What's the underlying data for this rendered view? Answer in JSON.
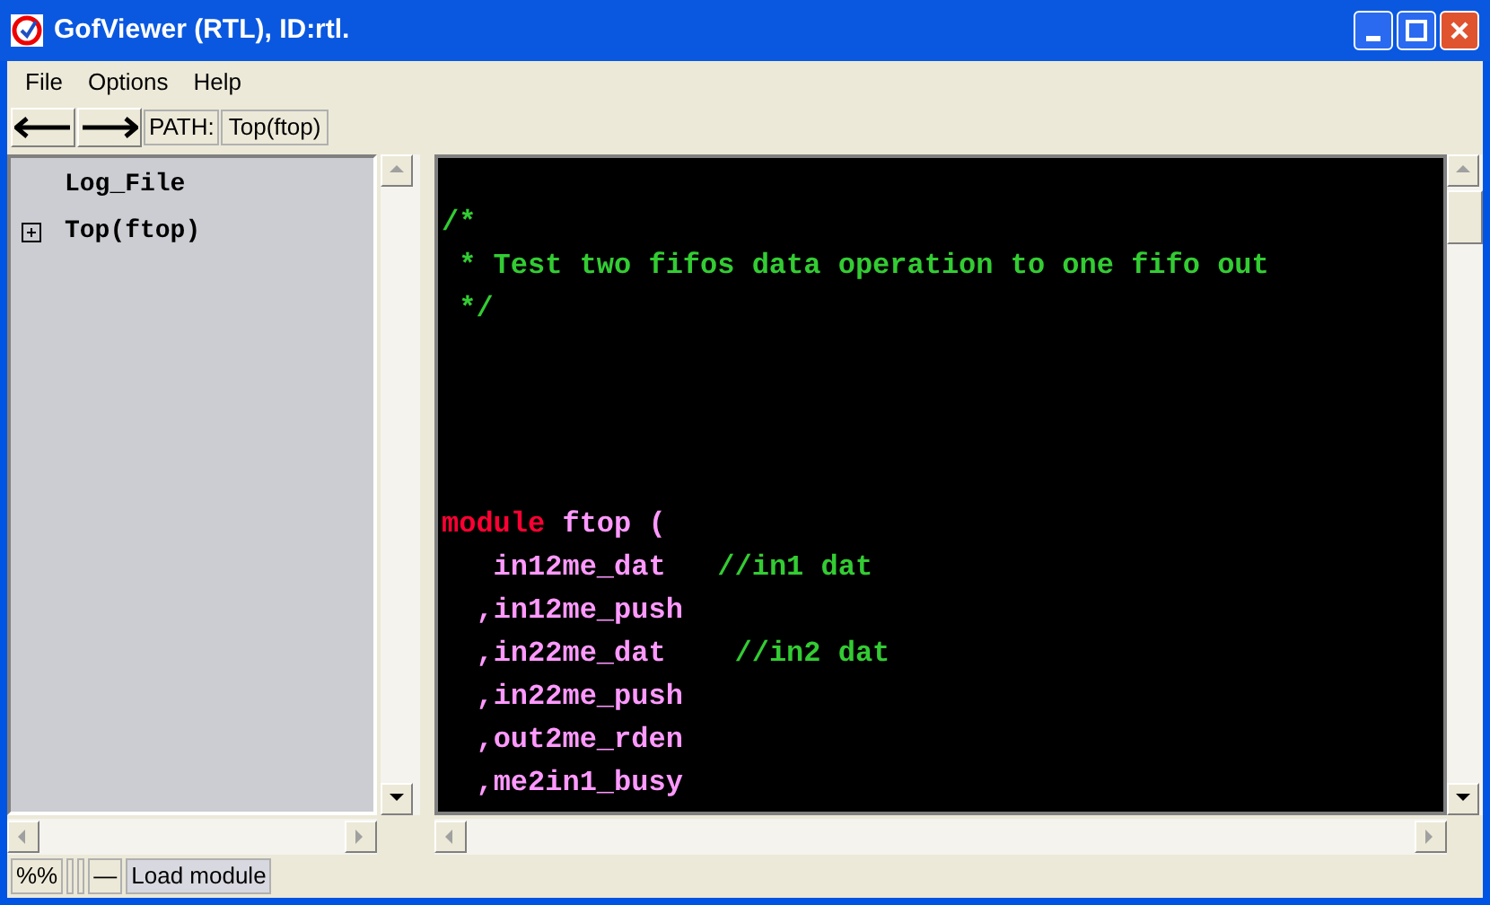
{
  "window": {
    "title": "GofViewer (RTL), ID:rtl."
  },
  "menu": [
    "File",
    "Options",
    "Help"
  ],
  "toolbar": {
    "path_label": "PATH:",
    "path": "Top(ftop)"
  },
  "tree": [
    {
      "label": "Log_File",
      "expandable": false
    },
    {
      "label": "Top(ftop)",
      "expandable": true
    }
  ],
  "code": [
    {
      "kind": "blank"
    },
    {
      "kind": "code",
      "tokens": [
        {
          "kind": "comment",
          "text": "/*"
        }
      ]
    },
    {
      "kind": "code",
      "tokens": [
        {
          "kind": "comment",
          "text": " * Test two fifos data operation to one fifo out"
        }
      ]
    },
    {
      "kind": "code",
      "tokens": [
        {
          "kind": "comment",
          "text": " */"
        }
      ]
    },
    {
      "kind": "blank"
    },
    {
      "kind": "blank"
    },
    {
      "kind": "blank"
    },
    {
      "kind": "blank"
    },
    {
      "kind": "code",
      "tokens": [
        {
          "kind": "keyword",
          "text": "module"
        },
        {
          "kind": "ident",
          "text": " ftop"
        },
        {
          "kind": "punct",
          "text": " ("
        }
      ]
    },
    {
      "kind": "code",
      "tokens": [
        {
          "kind": "ident",
          "text": "   in12me_dat"
        },
        {
          "kind": "comment",
          "text": "   //in1 dat"
        }
      ]
    },
    {
      "kind": "code",
      "tokens": [
        {
          "kind": "punct",
          "text": "  ,"
        },
        {
          "kind": "ident",
          "text": "in12me_push"
        }
      ]
    },
    {
      "kind": "code",
      "tokens": [
        {
          "kind": "punct",
          "text": "  ,"
        },
        {
          "kind": "ident",
          "text": "in22me_dat"
        },
        {
          "kind": "comment",
          "text": "    //in2 dat"
        }
      ]
    },
    {
      "kind": "code",
      "tokens": [
        {
          "kind": "punct",
          "text": "  ,"
        },
        {
          "kind": "ident",
          "text": "in22me_push"
        }
      ]
    },
    {
      "kind": "code",
      "tokens": [
        {
          "kind": "punct",
          "text": "  ,"
        },
        {
          "kind": "ident",
          "text": "out2me_rden"
        }
      ]
    },
    {
      "kind": "code",
      "tokens": [
        {
          "kind": "punct",
          "text": "  ,"
        },
        {
          "kind": "ident",
          "text": "me2in1_busy"
        }
      ]
    }
  ],
  "status": {
    "mode": "%%",
    "indicator": "—",
    "message": "Load module"
  }
}
